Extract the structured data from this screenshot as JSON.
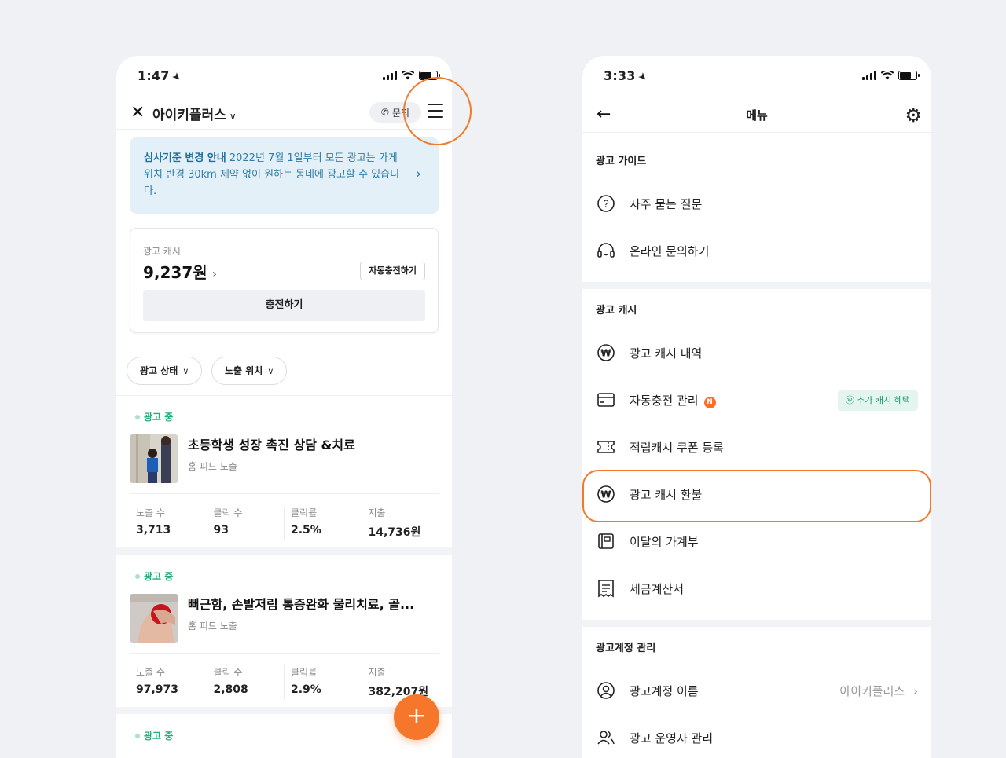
{
  "left": {
    "status": {
      "time": "1:47"
    },
    "header": {
      "account": "아이키플러스",
      "inquiry": "문의"
    },
    "notice": {
      "bold": "심사기준 변경 안내",
      "text": " 2022년 7월 1일부터 모든 광고는 가게 위치 반경 30km 제약 없이 원하는 동네에 광고할 수 있습니다."
    },
    "cash": {
      "label": "광고 캐시",
      "amount": "9,237원",
      "auto_button": "자동충전하기",
      "charge_button": "충전하기"
    },
    "filters": {
      "status": "광고 상태",
      "placement": "노출 위치"
    },
    "stat_labels": {
      "impressions": "노출 수",
      "clicks": "클릭 수",
      "ctr": "클릭률",
      "spend": "지출"
    },
    "ads": [
      {
        "status": "광고 중",
        "title": "초등학생 성장 촉진 상담 &치료",
        "placement": "홈 피드 노출",
        "impressions": "3,713",
        "clicks": "93",
        "ctr": "2.5%",
        "spend": "14,736원"
      },
      {
        "status": "광고 중",
        "title": "뻐근함, 손발저림 통증완화 물리치료, 골...",
        "placement": "홈 피드 노출",
        "impressions": "97,973",
        "clicks": "2,808",
        "ctr": "2.9%",
        "spend": "382,207원"
      },
      {
        "status": "광고 중"
      }
    ],
    "fab": "+"
  },
  "right": {
    "status": {
      "time": "3:33"
    },
    "header": {
      "title": "메뉴"
    },
    "sections": {
      "guide": "광고 가이드",
      "cash": "광고 캐시",
      "account": "광고계정 관리"
    },
    "items": {
      "faq": "자주 묻는 질문",
      "online_inquiry": "온라인 문의하기",
      "cash_history": "광고 캐시 내역",
      "auto_charge": "자동충전 관리",
      "auto_charge_badge": "N",
      "bonus_tag": "추가 캐시 혜택",
      "coupon": "적립캐시 쿠폰 등록",
      "refund": "광고 캐시 환불",
      "ledger": "이달의 가계부",
      "tax_invoice": "세금계산서",
      "account_name": "광고계정 이름",
      "account_name_value": "아이키플러스",
      "operators": "광고 운영자 관리"
    }
  },
  "colors": {
    "accent": "#f07b2b",
    "active": "#1fae7f",
    "notice_bg": "#e3f0f7"
  }
}
